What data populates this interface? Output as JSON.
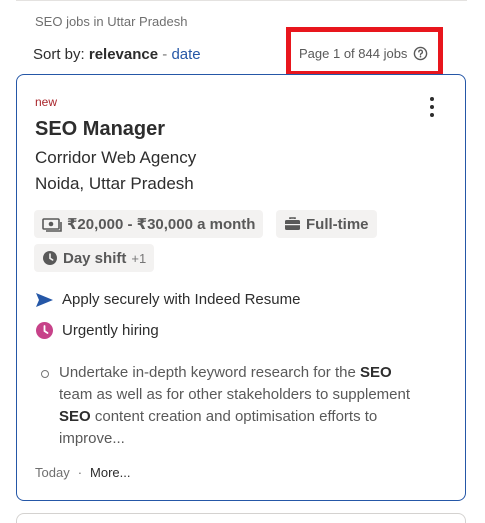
{
  "header": {
    "title": "SEO jobs in Uttar Pradesh"
  },
  "sort": {
    "label": "Sort by:",
    "active": "relevance",
    "separator": "-",
    "alt": "date"
  },
  "pagination": {
    "text": "Page 1 of 844 jobs",
    "help_icon": "question-circle-icon"
  },
  "job": {
    "tag": "new",
    "title": "SEO Manager",
    "company": "Corridor Web Agency",
    "location": "Noida, Uttar Pradesh",
    "salary": "₹20,000 - ₹30,000 a month",
    "job_type": "Full-time",
    "shift": "Day shift",
    "shift_more": "+1",
    "apply_text": "Apply securely with Indeed Resume",
    "urgent_text": "Urgently hiring",
    "snippet": {
      "p1": "Undertake in-depth keyword research for the ",
      "b1": "SEO",
      "p2": " team as well as for other stakeholders to supplement ",
      "b2": "SEO",
      "p3": " content creation and optimisation efforts to improve..."
    },
    "posted": "Today",
    "dot": "·",
    "more": "More..."
  },
  "colors": {
    "accent": "#2557a7",
    "highlight": "#e8161d",
    "urgent": "#c74289",
    "new": "#a9252b"
  }
}
